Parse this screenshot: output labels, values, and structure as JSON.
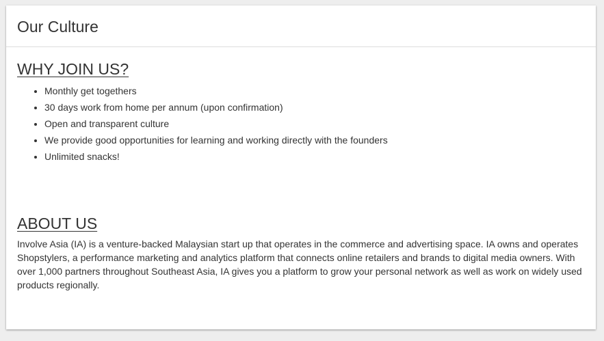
{
  "card": {
    "title": "Our Culture"
  },
  "why_join": {
    "heading": "WHY JOIN US?",
    "items": [
      "Monthly get togethers",
      "30 days work from home per annum (upon confirmation)",
      "Open and transparent culture",
      "We provide good opportunities for learning and working directly with the founders",
      "Unlimited snacks!"
    ]
  },
  "about": {
    "heading": "ABOUT US",
    "text": "Involve Asia (IA) is a venture-backed Malaysian start up that operates in the commerce and advertising space. IA owns and operates Shopstylers, a performance marketing and analytics platform that connects online retailers and brands to digital media owners. With over 1,000 partners throughout Southeast Asia, IA gives you a platform to grow your personal network as well as work on widely used products regionally."
  },
  "colors": {
    "background": "#eeeeee",
    "card": "#ffffff",
    "text": "#333333",
    "divider": "#dddddd"
  }
}
